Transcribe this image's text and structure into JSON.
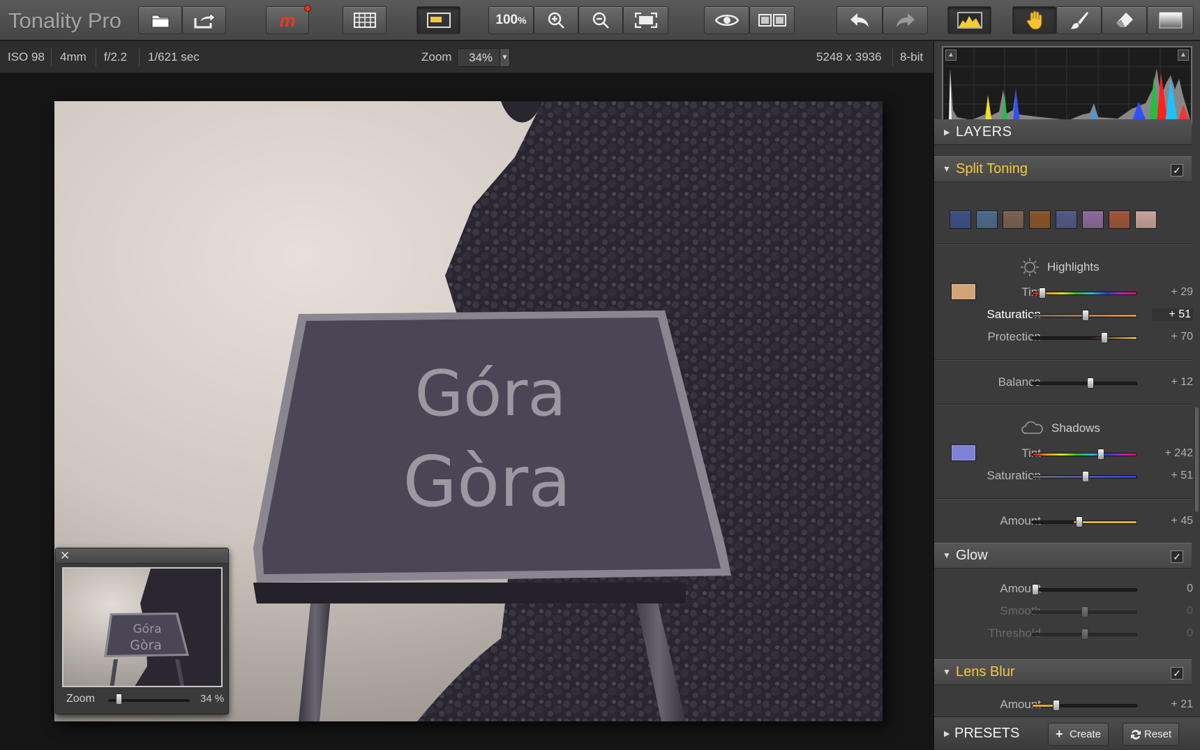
{
  "app": {
    "title": "Tonality Pro"
  },
  "toolbar": {
    "zoom_100": "100",
    "zoom_pct_sign": "%",
    "brand_letter": "m",
    "icons": [
      "open-icon",
      "export-icon",
      "plugin-icon",
      "batch-icon",
      "presets-toggle-icon",
      "zoom-in-icon",
      "zoom-out-icon",
      "fit-screen-icon",
      "preview-eye-icon",
      "compare-icon",
      "undo-icon",
      "redo-icon",
      "histogram-toggle-icon",
      "hand-tool-icon",
      "brush-tool-icon",
      "eraser-tool-icon",
      "gradient-tool-icon"
    ]
  },
  "info": {
    "iso": "ISO 98",
    "focal": "4mm",
    "aperture": "f/2.2",
    "shutter": "1/621 sec",
    "zoom_label": "Zoom",
    "zoom_value": "34%",
    "dimensions": "5248 x 3936",
    "bit_depth": "8-bit"
  },
  "photo": {
    "line1": "Góra",
    "line2": "Gòra"
  },
  "navigator": {
    "close": "✕",
    "zoom_label": "Zoom",
    "zoom_value": "34 %",
    "zoom_fraction": 0.1
  },
  "panel": {
    "layers_title": "LAYERS",
    "split_toning": {
      "title": "Split Toning",
      "checked": "✓",
      "swatches": [
        "#3b4f86",
        "#4a6a8c",
        "#7a5f52",
        "#8a5426",
        "#4f5888",
        "#8c6a9a",
        "#a15336",
        "#c9a39a"
      ],
      "highlights": {
        "label": "Highlights",
        "chip_color": "#d2a478",
        "tint": {
          "label": "Tint",
          "value": "+ 29",
          "fraction": 0.07
        },
        "saturation": {
          "label": "Saturation",
          "value": "+ 51",
          "fraction": 0.51
        },
        "protection": {
          "label": "Protection",
          "value": "+ 70",
          "fraction": 0.7
        }
      },
      "balance": {
        "label": "Balance",
        "value": "+ 12",
        "fraction": 0.56
      },
      "shadows": {
        "label": "Shadows",
        "chip_color": "#7f80d8",
        "tint": {
          "label": "Tint",
          "value": "+ 242",
          "fraction": 0.67
        },
        "saturation": {
          "label": "Saturation",
          "value": "+ 51",
          "fraction": 0.51
        }
      },
      "amount": {
        "label": "Amount",
        "value": "+ 45",
        "fraction": 0.45
      }
    },
    "glow": {
      "title": "Glow",
      "checked": "✓",
      "amount": {
        "label": "Amount",
        "value": "0",
        "fraction": 0.0
      },
      "smooth": {
        "label": "Smooth",
        "value": "0",
        "fraction": 0.5
      },
      "threshold": {
        "label": "Threshold",
        "value": "0",
        "fraction": 0.5
      }
    },
    "lens_blur": {
      "title": "Lens Blur",
      "checked": "✓",
      "amount": {
        "label": "Amount",
        "value": "+ 21",
        "fraction": 0.21
      }
    },
    "presets": {
      "title": "PRESETS",
      "create": "Create",
      "reset": "Reset"
    }
  },
  "colors": {
    "accent_yellow": "#f4c93a",
    "brand_red": "#e03020"
  }
}
